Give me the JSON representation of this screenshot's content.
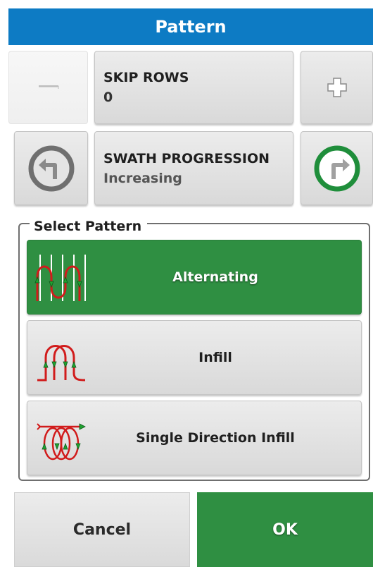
{
  "header": {
    "title": "Pattern"
  },
  "skip_rows": {
    "title": "SKIP ROWS",
    "value": "0",
    "minus_icon": "minus-icon",
    "plus_icon": "plus-icon"
  },
  "swath_progression": {
    "title": "SWATH PROGRESSION",
    "value": "Increasing",
    "left_icon": "rotate-left-icon",
    "right_icon": "rotate-right-icon"
  },
  "select_pattern": {
    "legend": "Select Pattern",
    "options": [
      {
        "label": "Alternating",
        "selected": true,
        "icon": "alternating-pattern-icon"
      },
      {
        "label": "Infill",
        "selected": false,
        "icon": "infill-pattern-icon"
      },
      {
        "label": "Single Direction Infill",
        "selected": false,
        "icon": "single-direction-infill-pattern-icon"
      }
    ]
  },
  "footer": {
    "cancel_label": "Cancel",
    "ok_label": "OK"
  },
  "colors": {
    "header": "#0d7bc4",
    "accent_green": "#2f8f42",
    "path_red": "#d11b1b",
    "arrow_green": "#1fa12f"
  }
}
